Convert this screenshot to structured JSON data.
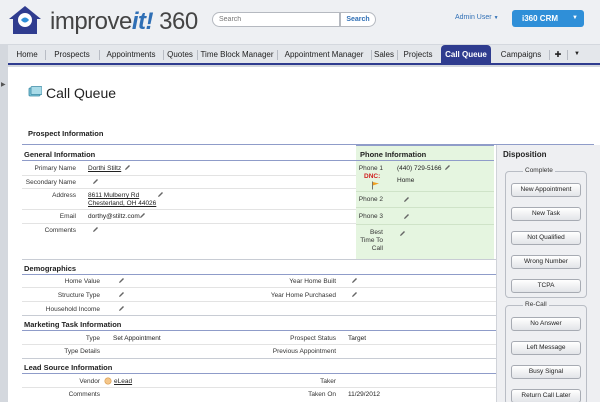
{
  "header": {
    "logo_prefix": "improve",
    "logo_it": "it!",
    "logo_suffix": " 360",
    "search_placeholder": "Search",
    "search_button": "Search",
    "user_menu": "Admin User",
    "app_switcher": "i360 CRM"
  },
  "nav": {
    "items": [
      "Home",
      "Prospects",
      "Appointments",
      "Quotes",
      "Time Block Manager",
      "Appointment Manager",
      "Sales",
      "Projects",
      "Call Queue",
      "Campaigns"
    ],
    "active": "Call Queue",
    "plus": "✚",
    "more": "▼"
  },
  "page": {
    "title": "Call Queue",
    "prospect_info": "Prospect Information"
  },
  "general": {
    "heading": "General Information",
    "primary_name_label": "Primary Name",
    "primary_name": "Dorthi Stiltz",
    "secondary_name_label": "Secondary Name",
    "address_label": "Address",
    "address_line1": "8611 Mulberry Rd",
    "address_line2": "Chesterland, OH 44026",
    "email_label": "Email",
    "email": "dorthy@stiltz.com",
    "comments_label": "Comments"
  },
  "phone": {
    "heading": "Phone Information",
    "phone1_label": "Phone 1",
    "dnc_label": "DNC:",
    "phone1_value": "(440) 729-5166",
    "phone1_type": "Home",
    "phone2_label": "Phone 2",
    "phone3_label": "Phone 3",
    "best_time_line1": "Best",
    "best_time_line2": "Time To",
    "best_time_line3": "Call"
  },
  "demographics": {
    "heading": "Demographics",
    "home_value_label": "Home Value",
    "structure_type_label": "Structure Type",
    "household_income_label": "Household Income",
    "year_built_label": "Year Home Built",
    "year_purchased_label": "Year Home Purchased"
  },
  "marketing": {
    "heading": "Marketing Task Information",
    "type_label": "Type",
    "type_value": "Set Appointment",
    "type_details_label": "Type Details",
    "prospect_status_label": "Prospect Status",
    "prospect_status_value": "Target",
    "previous_appt_label": "Previous Appointment"
  },
  "lead_source": {
    "heading": "Lead Source Information",
    "vendor_label": "Vendor",
    "vendor_value": "eLead",
    "comments_label": "Comments",
    "taker_label": "Taker",
    "taken_on_label": "Taken On",
    "taken_on_value": "11/29/2012"
  },
  "disposition": {
    "title": "Disposition",
    "complete_legend": "Complete",
    "complete_buttons": [
      "New Appointment",
      "New Task",
      "Not Qualified",
      "Wrong Number",
      "TCPA"
    ],
    "recall_legend": "Re-Call",
    "recall_buttons": [
      "No Answer",
      "Left Message",
      "Busy Signal",
      "Return Call Later"
    ]
  },
  "colors": {
    "nav_active": "#2f3c8f",
    "brand_blue": "#2f6fb5",
    "crm_button": "#2f8fd8",
    "phone_panel_bg": "#e5f5e0",
    "dnc_red": "#d02020"
  }
}
